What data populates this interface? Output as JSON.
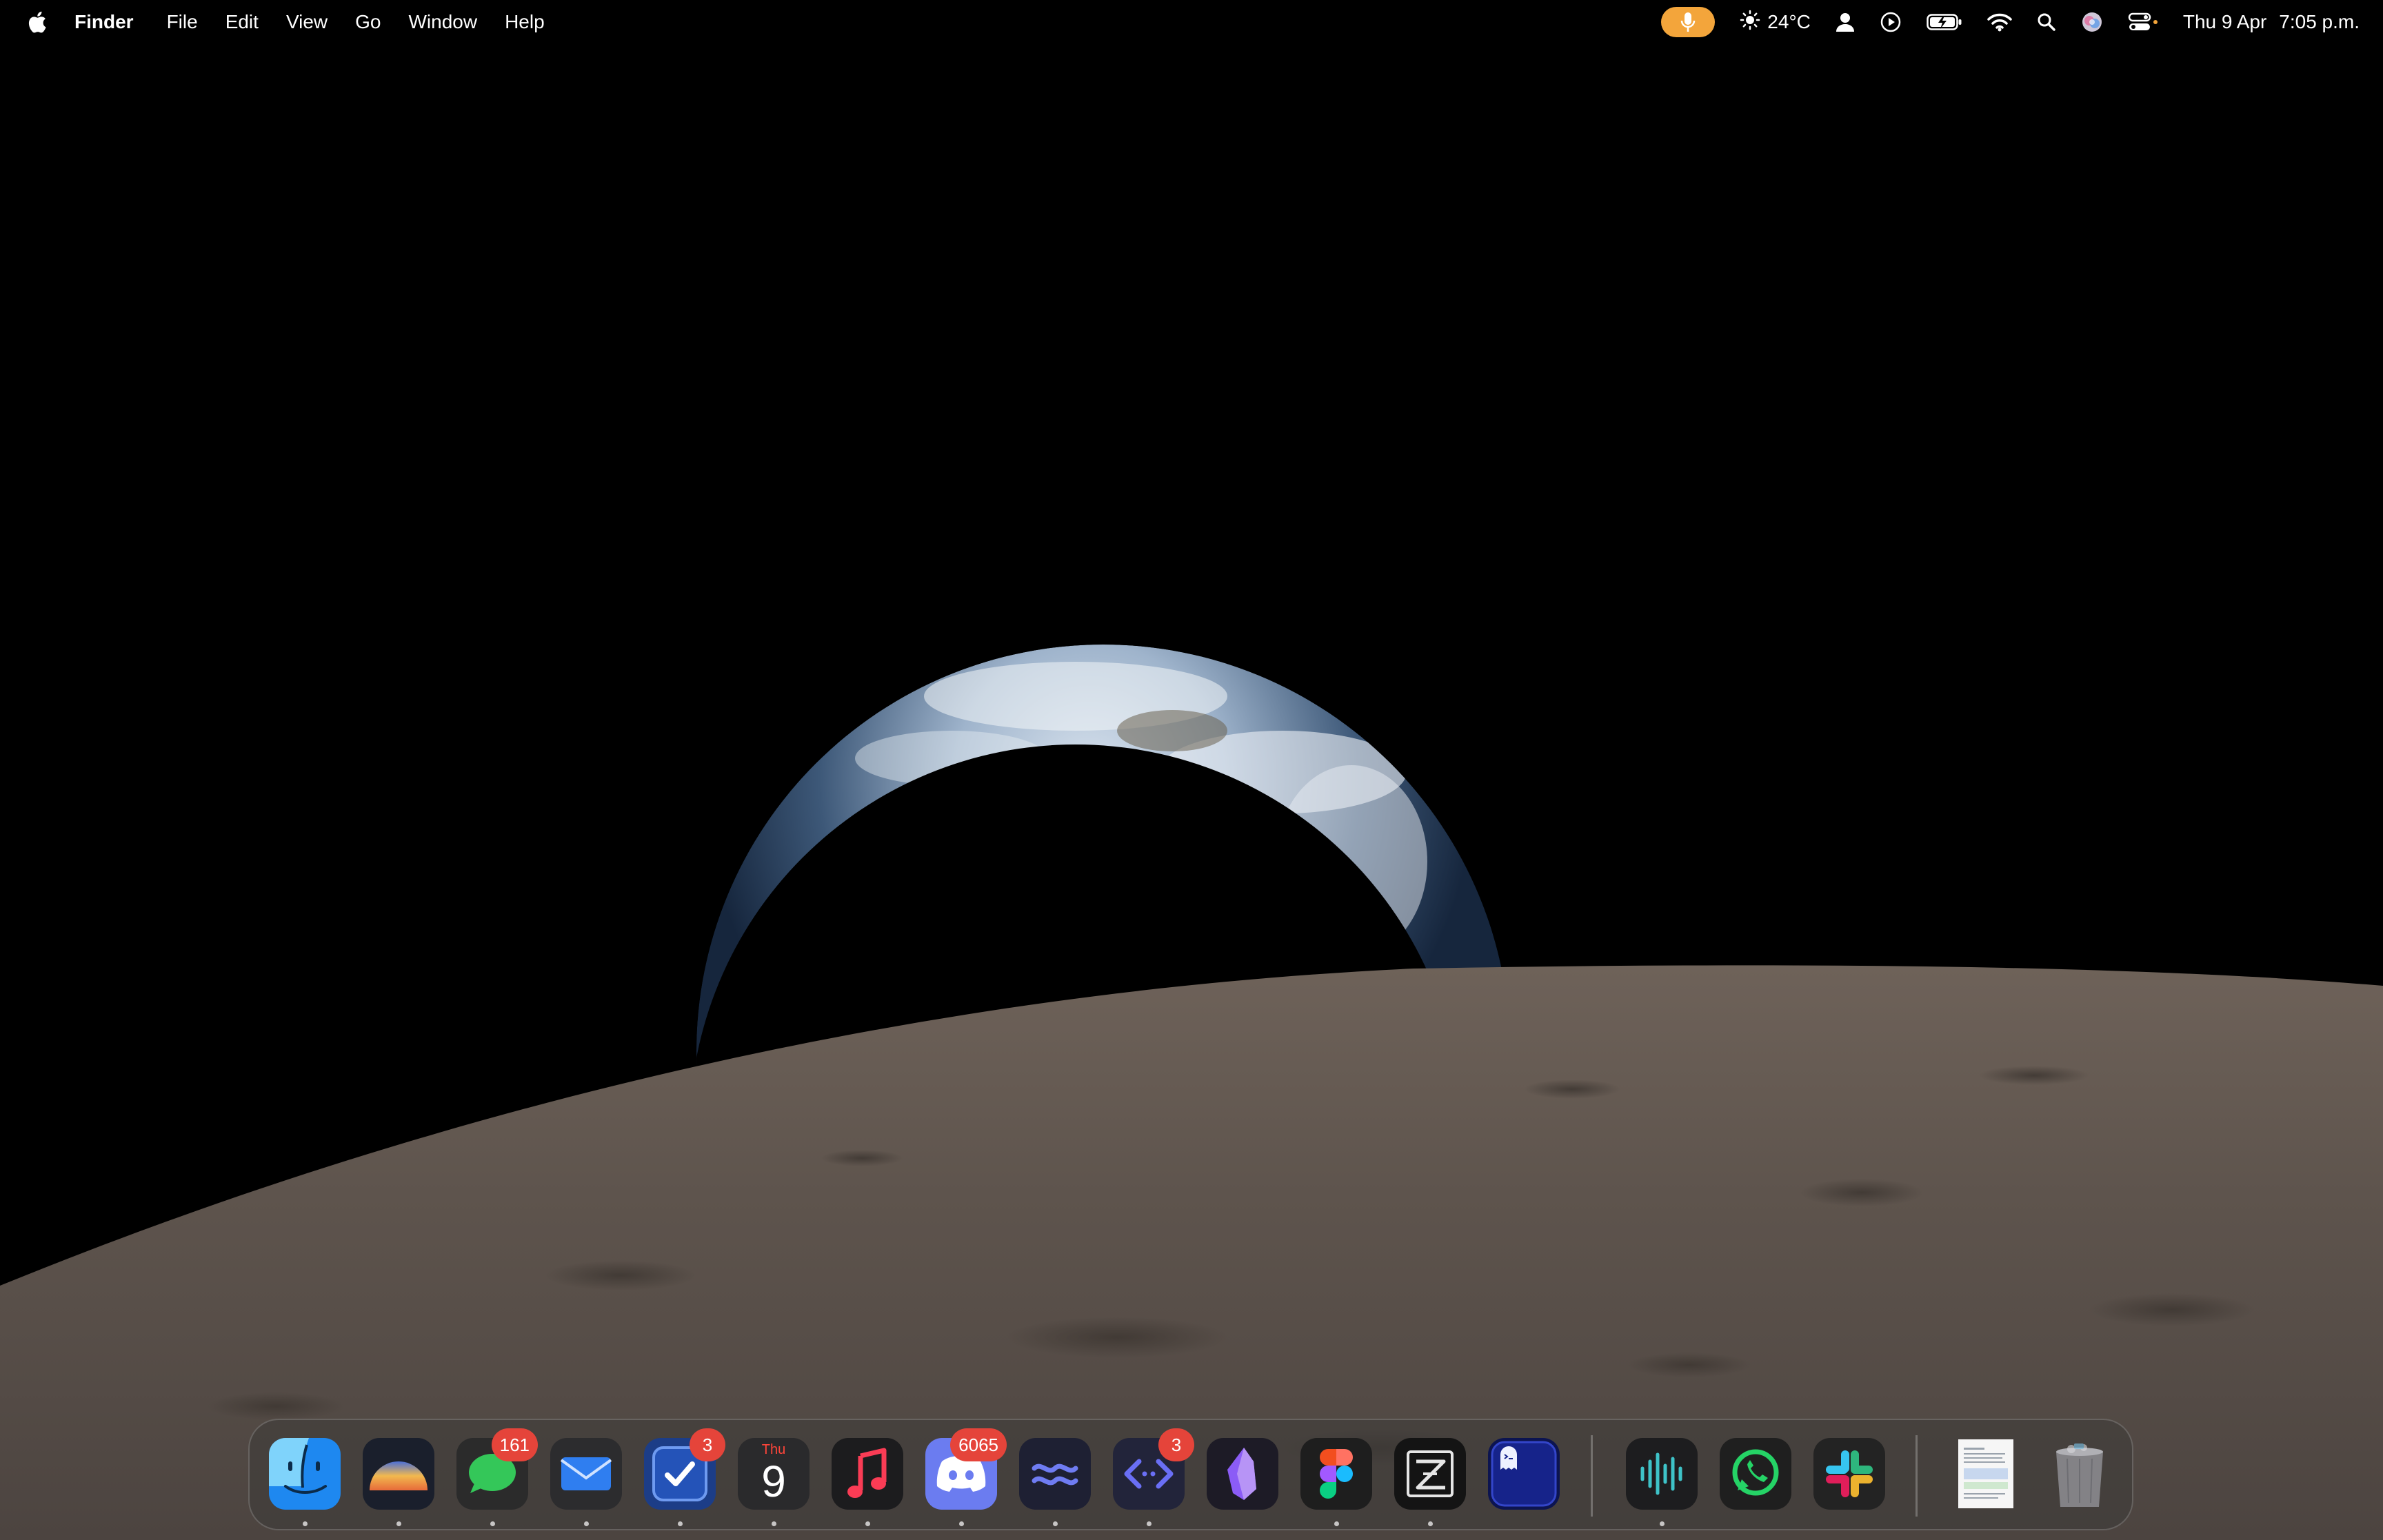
{
  "menubar": {
    "apple_icon": "apple-logo-icon",
    "app_name": "Finder",
    "menus": [
      "File",
      "Edit",
      "View",
      "Go",
      "Window",
      "Help"
    ],
    "status": {
      "mic_icon": "microphone-icon",
      "mic_color": "#f3a53b",
      "weather_icon": "sun-icon",
      "temperature": "24°C",
      "user_icon": "user-icon",
      "play_icon": "play-circle-icon",
      "battery_icon": "battery-charging-icon",
      "wifi_icon": "wifi-icon",
      "search_icon": "spotlight-search-icon",
      "siri_icon": "siri-icon",
      "control_center_icon": "control-center-icon",
      "date": "Thu 9 Apr",
      "time": "7:05 p.m."
    }
  },
  "wallpaper": {
    "description_icon": "earthrise-wallpaper"
  },
  "dock": {
    "apps": [
      {
        "name": "Finder",
        "icon": "finder-icon",
        "badge": "",
        "running": true
      },
      {
        "name": "Arc",
        "icon": "sunrise-browser-icon",
        "badge": "",
        "running": true
      },
      {
        "name": "Messages",
        "icon": "messages-icon",
        "badge": "161",
        "running": true
      },
      {
        "name": "Mail",
        "icon": "mail-icon",
        "badge": "",
        "running": true
      },
      {
        "name": "Things",
        "icon": "checkbox-icon",
        "badge": "3",
        "running": true
      },
      {
        "name": "Calendar",
        "icon": "calendar-icon",
        "badge": "",
        "running": true,
        "cal_day": "Thu",
        "cal_date": "9"
      },
      {
        "name": "Music",
        "icon": "music-icon",
        "badge": "",
        "running": true
      },
      {
        "name": "Discord",
        "icon": "discord-icon",
        "badge": "6065",
        "running": true
      },
      {
        "name": "Waves",
        "icon": "waves-icon",
        "badge": "",
        "running": true
      },
      {
        "name": "Code Editor",
        "icon": "code-brackets-icon",
        "badge": "3",
        "running": true
      },
      {
        "name": "Obsidian",
        "icon": "obsidian-crystal-icon",
        "badge": "",
        "running": false
      },
      {
        "name": "Figma",
        "icon": "figma-icon",
        "badge": "",
        "running": true
      },
      {
        "name": "Zed",
        "icon": "zed-icon",
        "badge": "",
        "running": true
      },
      {
        "name": "Terminal Ghost",
        "icon": "ghost-terminal-icon",
        "badge": "",
        "running": false
      },
      {
        "name": "Voice Memos",
        "icon": "waveform-icon",
        "badge": "",
        "running": true
      },
      {
        "name": "WhatsApp",
        "icon": "whatsapp-icon",
        "badge": "",
        "running": false
      },
      {
        "name": "Slack",
        "icon": "slack-icon",
        "badge": "",
        "running": false
      },
      {
        "name": "Document",
        "icon": "document-icon",
        "badge": "",
        "running": false
      },
      {
        "name": "Trash",
        "icon": "trash-icon",
        "badge": "",
        "running": false
      }
    ]
  }
}
